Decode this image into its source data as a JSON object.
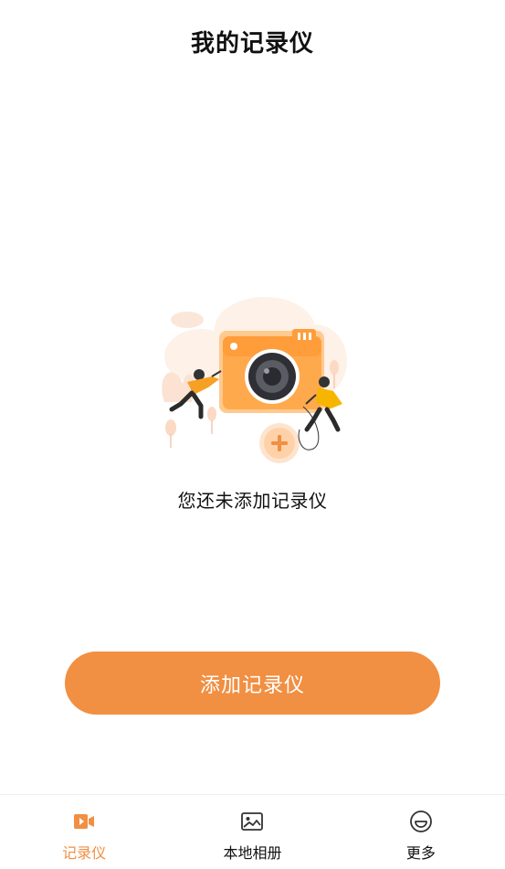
{
  "header": {
    "title": "我的记录仪"
  },
  "empty_state": {
    "illustration": "camera-with-people-illustration",
    "message": "您还未添加记录仪"
  },
  "primary_action": {
    "label": "添加记录仪"
  },
  "tabbar": {
    "active_index": 0,
    "accent_color": "#f18f42",
    "items": [
      {
        "label": "记录仪",
        "icon": "video-camera-icon"
      },
      {
        "label": "本地相册",
        "icon": "photo-album-icon"
      },
      {
        "label": "更多",
        "icon": "smile-face-icon"
      }
    ]
  },
  "colors": {
    "accent": "#f18f42",
    "text": "#111111",
    "background": "#ffffff"
  }
}
